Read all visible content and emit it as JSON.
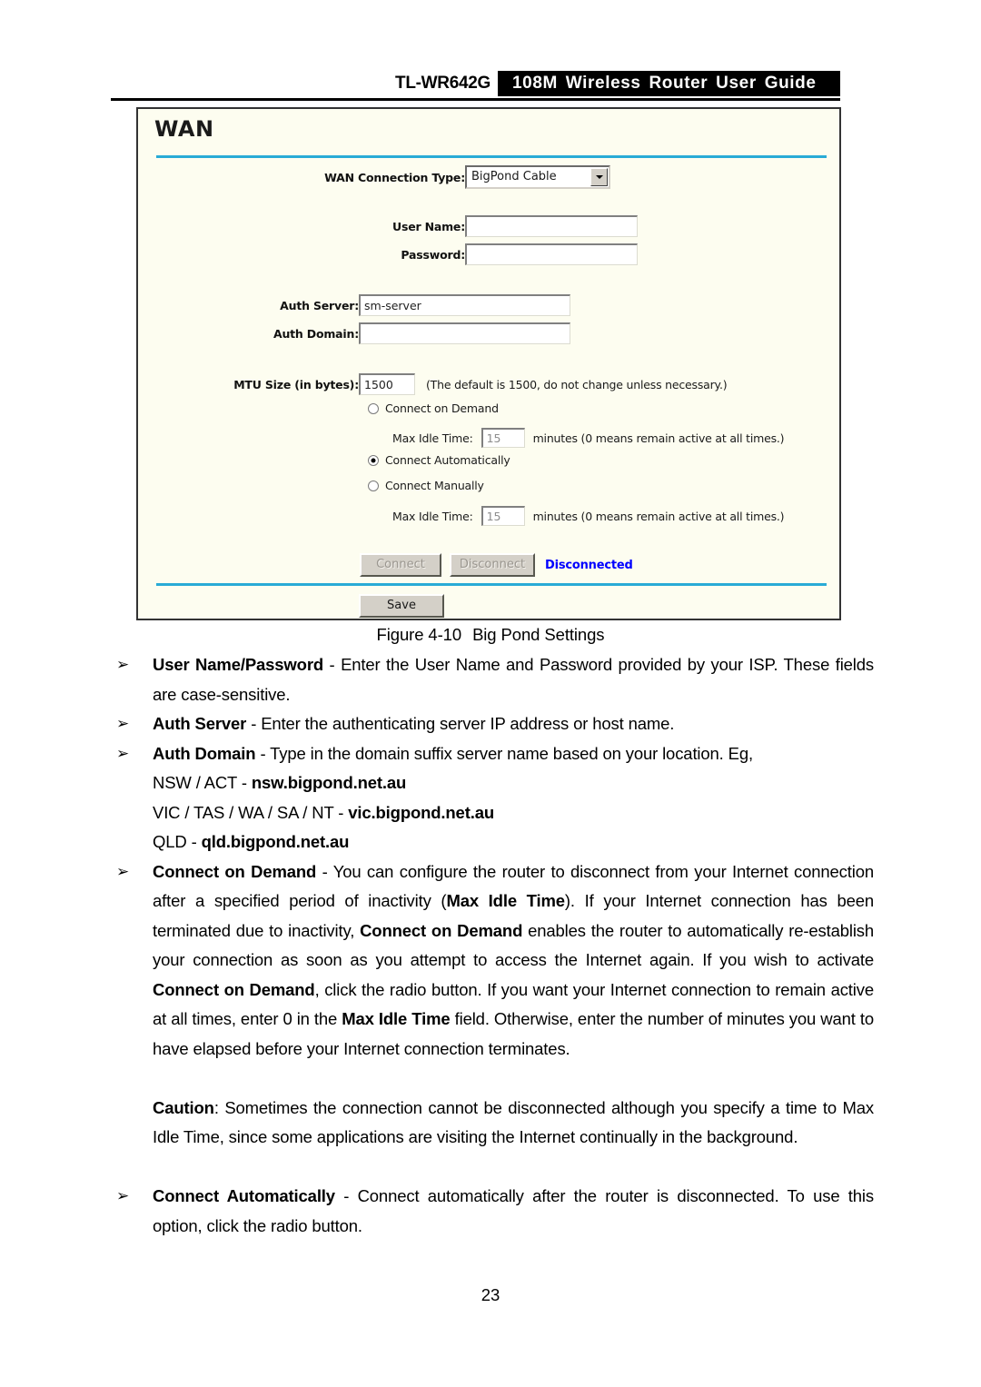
{
  "header": {
    "model": "TL-WR642G",
    "title": "108M Wireless Router User Guide"
  },
  "ui_panel": {
    "title": "WAN",
    "fields": {
      "wan_connection_type_label": "WAN Connection Type:",
      "wan_connection_type_value": "BigPond Cable",
      "user_name_label": "User Name:",
      "user_name_value": "",
      "password_label": "Password:",
      "password_value": "",
      "auth_server_label": "Auth Server:",
      "auth_server_value": "sm-server",
      "auth_domain_label": "Auth Domain:",
      "auth_domain_value": "",
      "mtu_label": "MTU Size (in bytes):",
      "mtu_value": "1500",
      "mtu_hint": "(The default is 1500, do not change unless necessary.)"
    },
    "radios": [
      {
        "label": "Connect on Demand",
        "checked": false
      },
      {
        "label": "Connect Automatically",
        "checked": true
      },
      {
        "label": "Connect Manually",
        "checked": false
      }
    ],
    "idle": {
      "label": "Max Idle Time:",
      "value_1": "15",
      "value_2": "15",
      "unit_hint": "minutes (0 means remain active at all times.)"
    },
    "buttons": {
      "connect": "Connect",
      "disconnect": "Disconnect",
      "save": "Save"
    },
    "status": "Disconnected",
    "status_color": "#0000ff",
    "accent_rule_color": "#29abd6",
    "panel_background": "#fdfdf0"
  },
  "figure_caption": {
    "number": "Figure 4-10",
    "text": "Big Pond Settings"
  },
  "body": {
    "bullet_marker": "➢",
    "items": [
      {
        "id": "user-name-password",
        "term": "User Name/Password",
        "dash": " - ",
        "text": "Enter the User Name and Password provided by your ISP. These fields are case-sensitive."
      },
      {
        "id": "auth-server",
        "term": "Auth Server",
        "dash": " - ",
        "text": "Enter the authenticating server IP address or host name."
      },
      {
        "id": "auth-domain",
        "term": "Auth Domain",
        "dash": " - ",
        "text": "Type in the domain suffix server name based on your location. Eg,"
      }
    ],
    "domain_examples": [
      {
        "region": "NSW / ACT - ",
        "domain": "nsw.bigpond.net.au"
      },
      {
        "region": "VIC / TAS / WA / SA / NT - ",
        "domain": "vic.bigpond.net.au"
      },
      {
        "region": "QLD - ",
        "domain": "qld.bigpond.net.au"
      }
    ],
    "connect_on_demand": {
      "term": "Connect on Demand",
      "dash": " - ",
      "p1": "You can configure the router to disconnect from your Internet connection after a specified period of inactivity (",
      "b1": "Max Idle Time",
      "p2": "). If your Internet connection has been terminated due to inactivity, ",
      "b2": "Connect on Demand",
      "p3": " enables the router to automatically re-establish your connection as soon as you attempt to access the Internet again. If you wish to activate ",
      "b3": "Connect on Demand",
      "p4": ", click the radio button. If you want your Internet connection to remain active at all times, enter 0 in the ",
      "b4": "Max Idle Time",
      "p5": " field. Otherwise, enter the number of minutes you want to have elapsed before your Internet connection terminates."
    },
    "caution": {
      "term": "Caution",
      "text": ": Sometimes the connection cannot be disconnected although you specify a time to Max Idle Time, since some applications are visiting the Internet continually in the background."
    },
    "connect_automatically": {
      "term": "Connect Automatically",
      "dash": " - ",
      "text": "Connect automatically after the router is disconnected. To use this option, click the radio button."
    }
  },
  "page_number": "23"
}
